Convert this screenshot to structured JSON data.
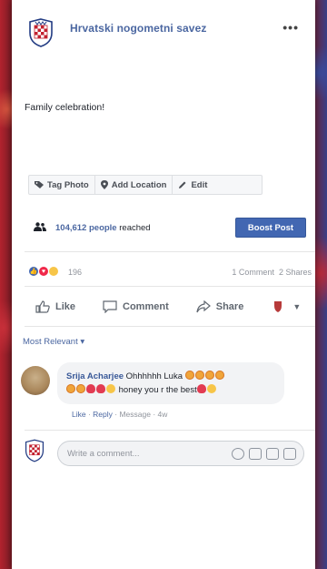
{
  "post": {
    "page_name": "Hrvatski nogometni savez",
    "more_label": "•••",
    "text": "Family celebration!"
  },
  "photo_actions": {
    "tag": "Tag Photo",
    "location": "Add Location",
    "edit": "Edit"
  },
  "reach": {
    "count": "104,612 people",
    "suffix": " reached",
    "boost_label": "Boost Post"
  },
  "reactions": {
    "count": "196",
    "comments": "1 Comment",
    "shares": "2 Shares"
  },
  "actions": {
    "like": "Like",
    "comment": "Comment",
    "share": "Share"
  },
  "comments": {
    "sort_label": "Most Relevant ▾",
    "items": [
      {
        "author": "Srija Acharjee",
        "text_1": " Ohhhhhh Luka",
        "text_2": " honey you r the best",
        "like": "Like",
        "reply": "Reply",
        "message": "Message",
        "time": "4w"
      }
    ]
  },
  "composer": {
    "placeholder": "Write a comment..."
  },
  "colors": {
    "brand_blue": "#4267b2",
    "link_blue": "#4b67a1"
  },
  "icons": [
    "hns-crest",
    "more-icon",
    "tag-icon",
    "location-pin-icon",
    "pencil-icon",
    "people-icon",
    "like-icon",
    "comment-icon",
    "share-icon",
    "emoji-icon",
    "camera-icon",
    "gif-icon",
    "sticker-icon"
  ]
}
